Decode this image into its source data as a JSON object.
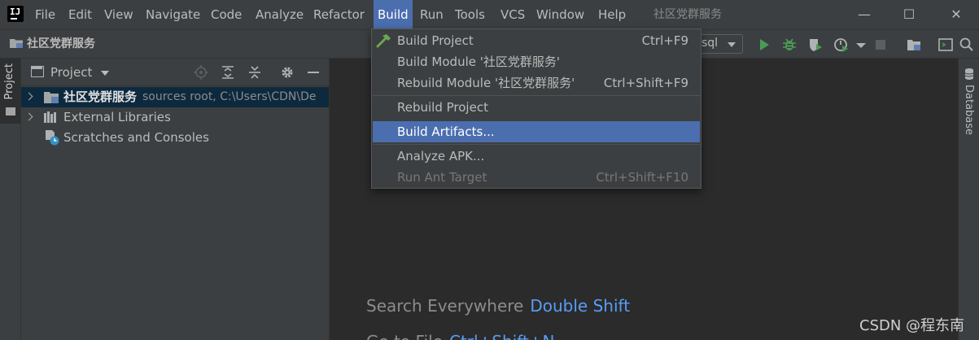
{
  "menubar": {
    "items": [
      {
        "label": "File",
        "active": false
      },
      {
        "label": "Edit",
        "active": false
      },
      {
        "label": "View",
        "active": false
      },
      {
        "label": "Navigate",
        "active": false
      },
      {
        "label": "Code",
        "active": false
      },
      {
        "label": "Analyze",
        "active": false
      },
      {
        "label": "Refactor",
        "active": false
      },
      {
        "label": "Build",
        "active": true
      },
      {
        "label": "Run",
        "active": false
      },
      {
        "label": "Tools",
        "active": false
      },
      {
        "label": "VCS",
        "active": false
      },
      {
        "label": "Window",
        "active": false
      },
      {
        "label": "Help",
        "active": false
      }
    ],
    "project_title": "社区党群服务",
    "window_controls": {
      "minimize": "—",
      "maximize": "☐",
      "close": "✕"
    }
  },
  "navbar": {
    "title": "社区党群服务",
    "run_config": "sql"
  },
  "leftstrip": {
    "project_tab": "Project"
  },
  "project_panel": {
    "header_label": "Project",
    "tree": [
      {
        "label": "社区党群服务",
        "hint": "sources root,  C:\\Users\\CDN\\De",
        "selected": true,
        "expandable": true
      },
      {
        "label": "External Libraries",
        "hint": "",
        "selected": false,
        "expandable": true
      },
      {
        "label": "Scratches and Consoles",
        "hint": "",
        "selected": false,
        "expandable": false
      }
    ]
  },
  "rightstrip": {
    "database_tab": "Database"
  },
  "build_menu": {
    "items": [
      {
        "label": "Build Project",
        "shortcut": "Ctrl+F9",
        "highlighted": false,
        "disabled": false
      },
      {
        "label": "Build Module '社区党群服务'",
        "shortcut": "",
        "highlighted": false,
        "disabled": false
      },
      {
        "label": "Rebuild Module '社区党群服务'",
        "shortcut": "Ctrl+Shift+F9",
        "highlighted": false,
        "disabled": false
      },
      {
        "label": "Rebuild Project",
        "shortcut": "",
        "highlighted": false,
        "disabled": false
      },
      {
        "label": "Build Artifacts...",
        "shortcut": "",
        "highlighted": true,
        "disabled": false
      },
      {
        "label": "Analyze APK...",
        "shortcut": "",
        "highlighted": false,
        "disabled": false
      },
      {
        "label": "Run Ant Target",
        "shortcut": "Ctrl+Shift+F10",
        "highlighted": false,
        "disabled": true
      }
    ]
  },
  "editor": {
    "hint1_text": "Search Everywhere",
    "hint1_key": "Double Shift",
    "hint2_text": "Go to File",
    "hint2_key": "Ctrl+Shift+N"
  },
  "watermark": "CSDN @程东南",
  "colors": {
    "menu_bg": "#3c3f41",
    "editor_bg": "#2b2b2b",
    "highlight": "#4b6eaf",
    "selection": "#0d293e",
    "link": "#589df6"
  }
}
